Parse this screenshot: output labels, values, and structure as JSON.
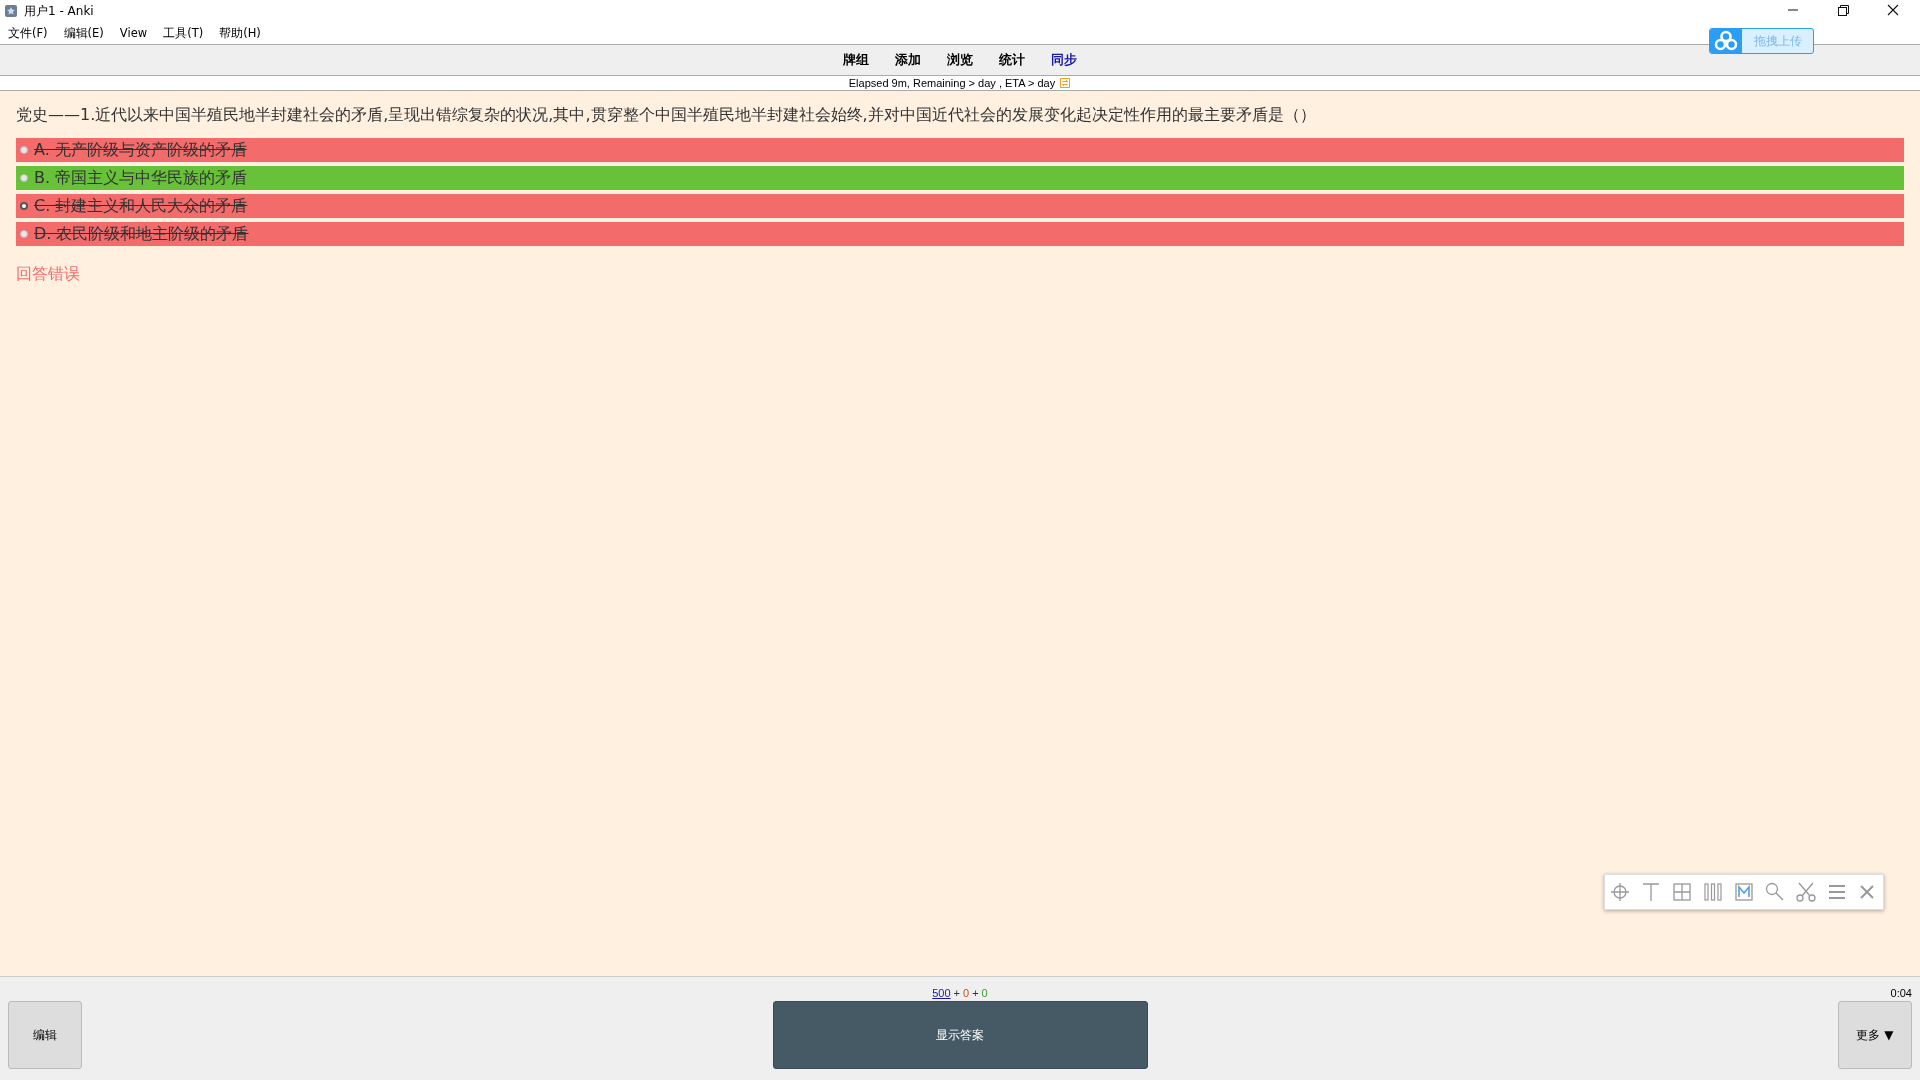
{
  "window": {
    "title": "用户1 - Anki"
  },
  "menu": [
    {
      "label": "文件(F)"
    },
    {
      "label": "编辑(E)"
    },
    {
      "label": "View"
    },
    {
      "label": "工具(T)"
    },
    {
      "label": "帮助(H)"
    }
  ],
  "upload_button": {
    "label": "拖拽上传"
  },
  "toolbar": [
    {
      "label": "牌组",
      "highlight": false
    },
    {
      "label": "添加",
      "highlight": false
    },
    {
      "label": "浏览",
      "highlight": false
    },
    {
      "label": "统计",
      "highlight": false
    },
    {
      "label": "同步",
      "highlight": true
    }
  ],
  "progress": {
    "text": "Elapsed 9m, Remaining > day , ETA > day",
    "sync_icon": true
  },
  "card": {
    "question": "党史——1.近代以来中国半殖民地半封建社会的矛盾,呈现出错综复杂的状况,其中,贯穿整个中国半殖民地半封建社会始终,并对中国近代社会的发展变化起决定性作用的最主要矛盾是（）",
    "options": [
      {
        "label": "A. 无产阶级与资产阶级的矛盾",
        "correct": false,
        "selected": false
      },
      {
        "label": "B. 帝国主义与中华民族的矛盾",
        "correct": true,
        "selected": false
      },
      {
        "label": "C. 封建主义和人民大众的矛盾",
        "correct": false,
        "selected": true
      },
      {
        "label": "D. 农民阶级和地主阶级的矛盾",
        "correct": false,
        "selected": false
      }
    ],
    "result": "回答错误"
  },
  "bottom": {
    "counts": [
      {
        "value": "500",
        "kind": "current"
      },
      {
        "value": "+",
        "kind": "sep"
      },
      {
        "value": "0",
        "kind": "learn"
      },
      {
        "value": "+",
        "kind": "sep"
      },
      {
        "value": "0",
        "kind": "review"
      }
    ],
    "timer": "0:04",
    "edit_button": "编辑",
    "answer_button": "显示答案",
    "more_button": "更多 ▼"
  }
}
